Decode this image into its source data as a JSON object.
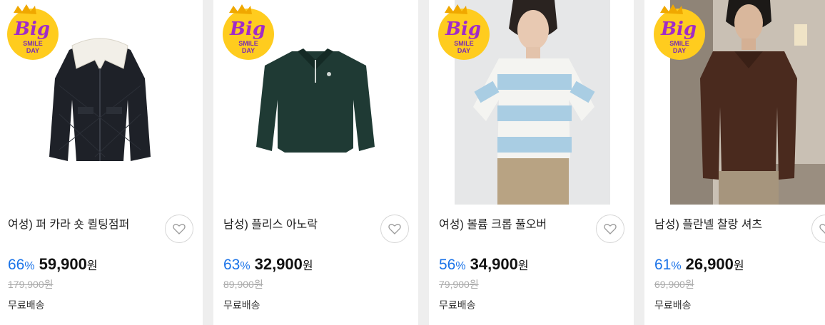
{
  "badge": {
    "line1": "Big",
    "line2": "SMILE",
    "line3": "DAY"
  },
  "products": [
    {
      "title": "여성) 퍼 카라 숏 퀼팅점퍼",
      "discount": "66",
      "pct": "%",
      "price": "59,900",
      "unit": "원",
      "original": "179,900원",
      "shipping": "무료배송"
    },
    {
      "title": "남성) 플리스 아노락",
      "discount": "63",
      "pct": "%",
      "price": "32,900",
      "unit": "원",
      "original": "89,900원",
      "shipping": "무료배송"
    },
    {
      "title": "여성) 볼륨 크롭 풀오버",
      "discount": "56",
      "pct": "%",
      "price": "34,900",
      "unit": "원",
      "original": "79,900원",
      "shipping": "무료배송"
    },
    {
      "title": "남성) 플란넬 찰랑 셔츠",
      "discount": "61",
      "pct": "%",
      "price": "26,900",
      "unit": "원",
      "original": "69,900원",
      "shipping": "무료배송"
    }
  ]
}
